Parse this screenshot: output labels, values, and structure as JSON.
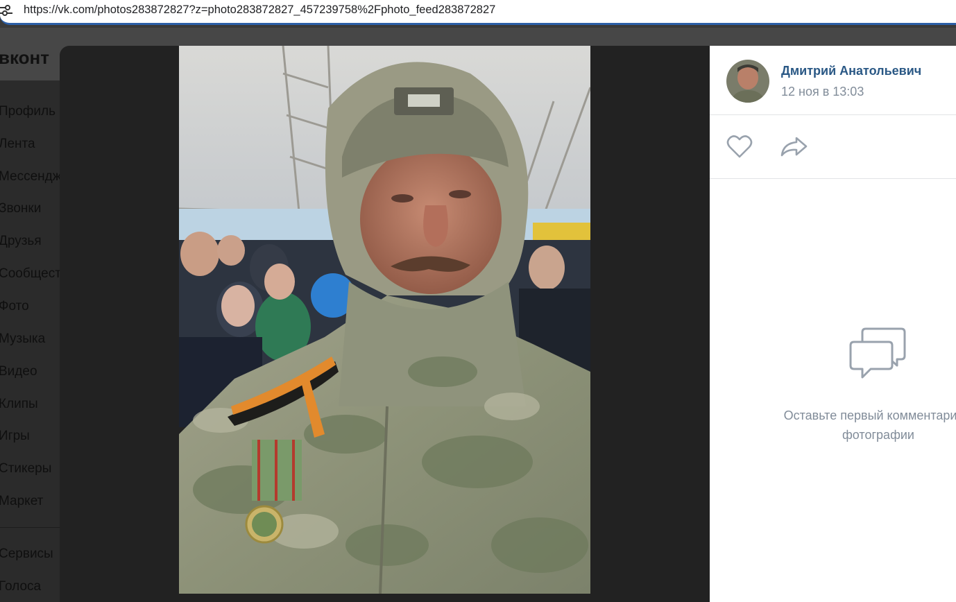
{
  "browser": {
    "url": "https://vk.com/photos283872827?z=photo283872827_457239758%2Fphoto_feed283872827",
    "site_info_icon": "tune-icon"
  },
  "site": {
    "logo_text": "вконт"
  },
  "left_nav": {
    "items": [
      {
        "label": "Профиль"
      },
      {
        "label": "Лента"
      },
      {
        "label": "Мессендж"
      },
      {
        "label": "Звонки"
      },
      {
        "label": "Друзья"
      },
      {
        "label": "Сообщест"
      },
      {
        "label": "Фото"
      },
      {
        "label": "Музыка"
      },
      {
        "label": "Видео"
      },
      {
        "label": "Клипы"
      },
      {
        "label": "Игры"
      },
      {
        "label": "Стикеры"
      },
      {
        "label": "Маркет"
      },
      {
        "label": "Сервисы"
      },
      {
        "label": "Голоса"
      }
    ]
  },
  "photo_viewer": {
    "author": {
      "name": "Дмитрий Анатольевич",
      "date": "12 ноя в 13:03",
      "avatar_icon": "user-avatar"
    },
    "actions": {
      "like_icon": "heart-icon",
      "share_icon": "share-arrow-icon"
    },
    "comments": {
      "icon": "comments-bubble-icon",
      "empty_line1": "Оставьте первый комментарий к",
      "empty_line2": "фотографии"
    }
  },
  "colors": {
    "link": "#2a5885",
    "muted": "#818c99",
    "accent": "#2c5fa8",
    "icon": "#99a2ad",
    "modal_bg": "#222222"
  }
}
